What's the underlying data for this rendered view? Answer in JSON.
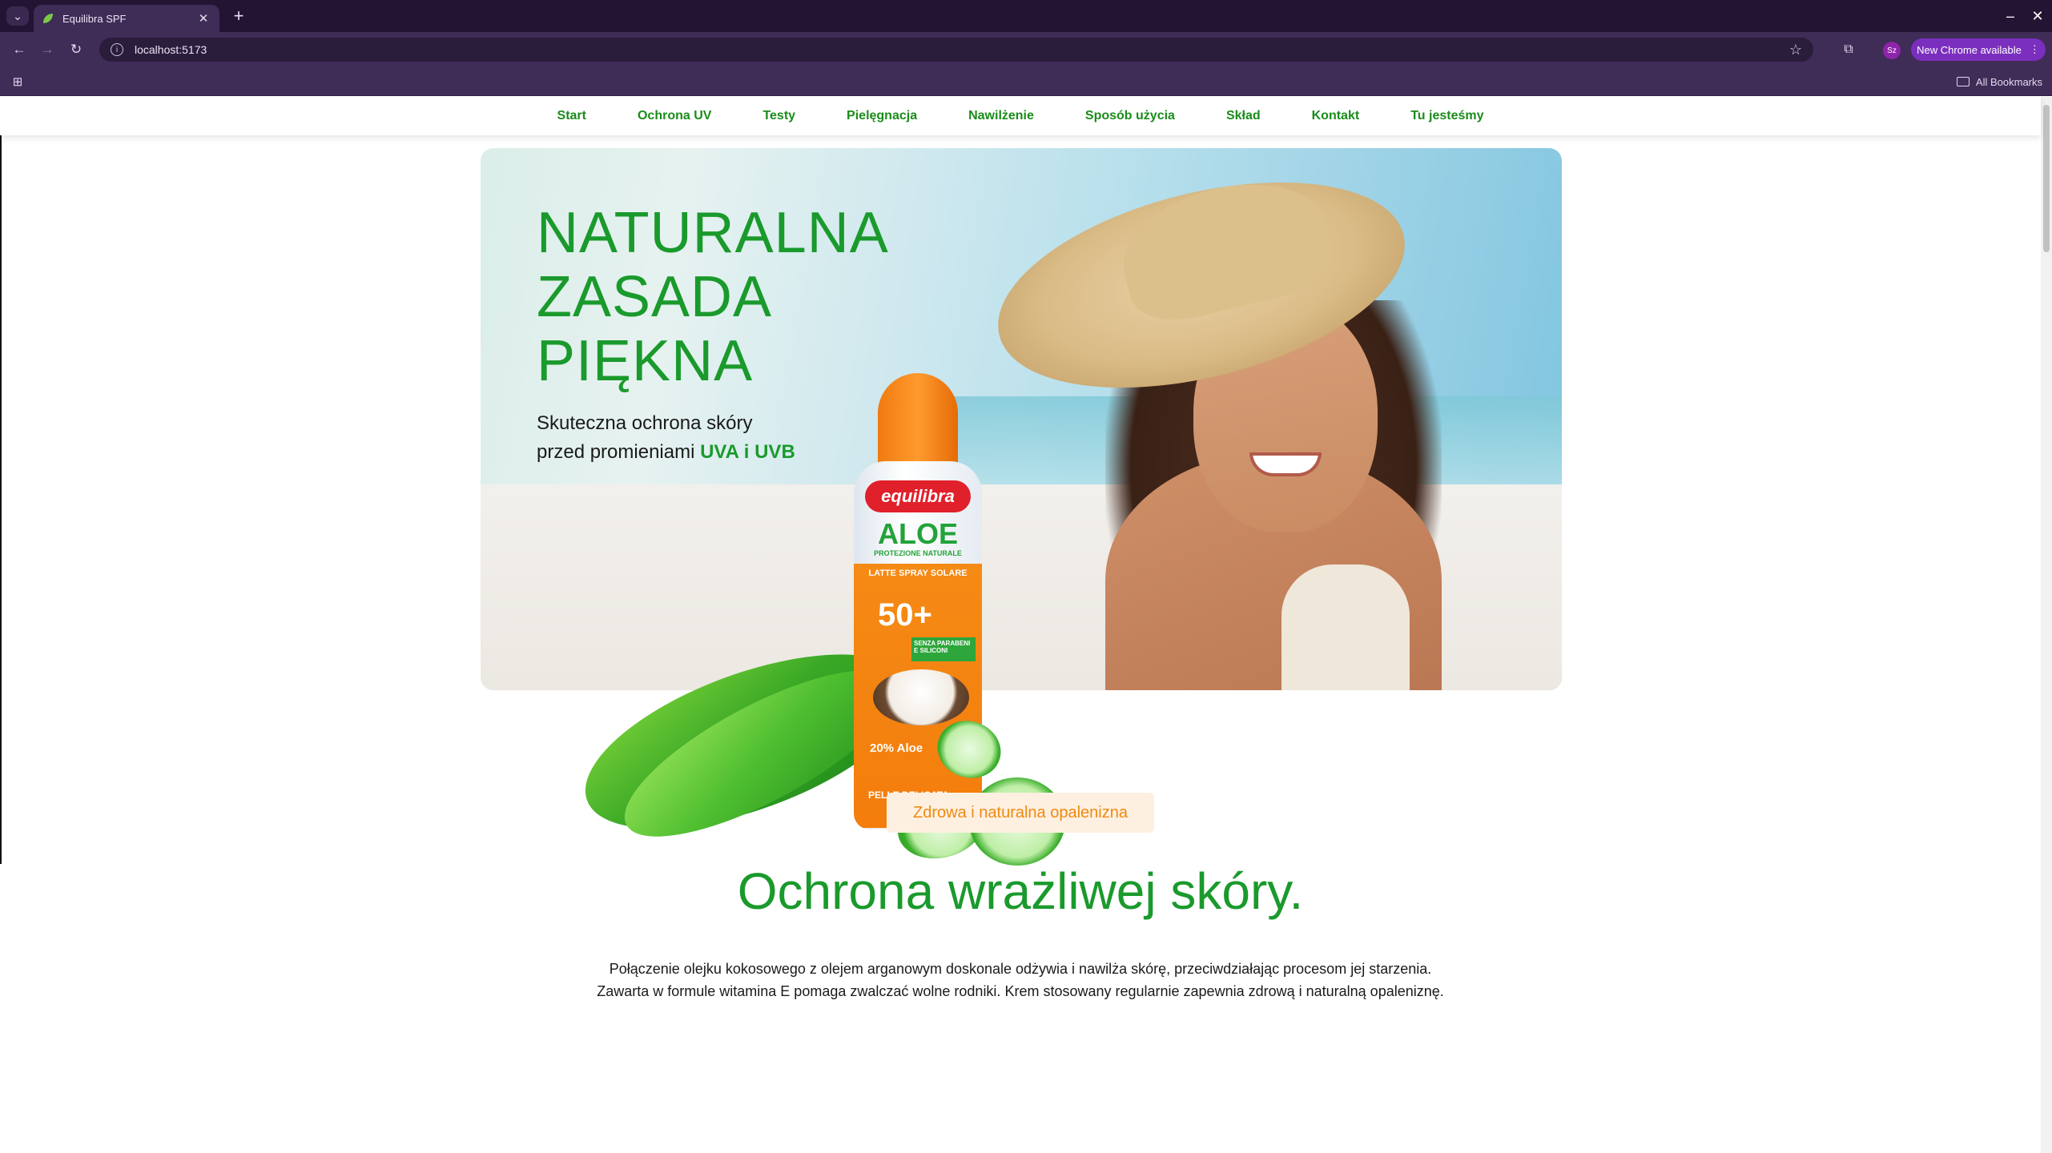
{
  "browser": {
    "tab_title": "Equilibra SPF",
    "url": "localhost:5173",
    "update_label": "New Chrome available",
    "profile_initials": "Sz",
    "all_bookmarks_label": "All Bookmarks"
  },
  "nav": {
    "items": [
      {
        "label": "Start"
      },
      {
        "label": "Ochrona UV"
      },
      {
        "label": "Testy"
      },
      {
        "label": "Pielęgnacja"
      },
      {
        "label": "Nawilżenie"
      },
      {
        "label": "Sposób użycia"
      },
      {
        "label": "Skład"
      },
      {
        "label": "Kontakt"
      },
      {
        "label": "Tu jesteśmy"
      }
    ]
  },
  "hero": {
    "title_lines": [
      "NATURALNA",
      "ZASADA",
      "PIĘKNA"
    ],
    "subtitle_line1": "Skuteczna ochrona skóry",
    "subtitle_line2_prefix": "przed promieniami ",
    "subtitle_highlight": "UVA i UVB"
  },
  "product": {
    "brand": "equilibra",
    "name": "ALOE",
    "name_sub": "PROTEZIONE NATURALE",
    "band_label": "LATTE SPRAY SOLARE",
    "spf": "50+",
    "green_label": "SENZA PARABENI E SILICONI",
    "aloe_percent": "20% Aloe",
    "skin_type": "PELLE DELICATA"
  },
  "section": {
    "badge": "Zdrowa i naturalna opalenizna",
    "title": "Ochrona wrażliwej skóry.",
    "text_line1": "Połączenie olejku kokosowego z olejem arganowym doskonale odżywia i nawilża skórę, przeciwdziałając procesom jej starzenia.",
    "text_line2": "Zawarta w formule witamina E pomaga zwalczać wolne rodniki. Krem stosowany regularnie zapewnia zdrową i naturalną opaleniznę."
  },
  "colors": {
    "brand_green": "#1a9a2c",
    "accent_orange": "#ef8a12",
    "chrome_bg": "#3f2c57"
  }
}
